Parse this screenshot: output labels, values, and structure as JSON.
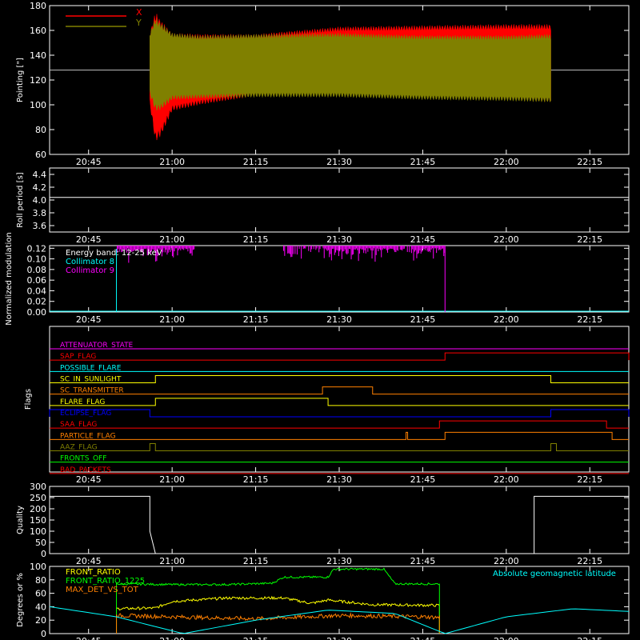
{
  "time_ticks": [
    "20:45",
    "21:00",
    "21:15",
    "21:30",
    "21:45",
    "22:00",
    "22:15"
  ],
  "colors": {
    "background": "#000000",
    "axis": "#ffffff",
    "x_pointing": "#ff0000",
    "y_pointing": "#808000",
    "collimator8": "#00ffff",
    "collimator9": "#ff00ff",
    "front_ratio": "#ffff00",
    "front_ratio_1225": "#00ff00",
    "max_det_vs_tot": "#ff8000",
    "geomag": "#00ffff"
  },
  "chart_data": [
    {
      "id": "pointing",
      "type": "line",
      "title": "",
      "ylabel": "Pointing [\"]",
      "xlim": [
        "20:38",
        "22:22"
      ],
      "ylim": [
        60,
        180
      ],
      "yticks": [
        "60",
        "80",
        "100",
        "120",
        "140",
        "160",
        "180"
      ],
      "reference_line": 128,
      "legend": {
        "placement": "top-left",
        "entries": [
          "X",
          "Y"
        ]
      },
      "series": [
        {
          "name": "X",
          "x": [
            "20:56",
            "20:57",
            "20:58",
            "21:00",
            "21:05",
            "21:15",
            "21:30",
            "21:45",
            "22:00",
            "22:08"
          ],
          "upper": [
            158,
            175,
            168,
            158,
            157,
            157,
            163,
            164,
            165,
            165
          ],
          "lower": [
            100,
            70,
            75,
            95,
            100,
            107,
            108,
            107,
            104,
            102
          ]
        },
        {
          "name": "Y",
          "x": [
            "20:56",
            "20:57",
            "20:58",
            "21:00",
            "21:05",
            "21:15",
            "21:30",
            "21:45",
            "22:00",
            "22:08"
          ],
          "upper": [
            158,
            170,
            166,
            158,
            156,
            157,
            158,
            156,
            156,
            157
          ],
          "lower": [
            108,
            95,
            96,
            104,
            105,
            106,
            106,
            104,
            103,
            102
          ]
        }
      ]
    },
    {
      "id": "roll",
      "type": "line",
      "ylabel": "Roll period [s]",
      "ylim": [
        3.5,
        4.5
      ],
      "yticks": [
        "3.6",
        "3.8",
        "4.0",
        "4.2",
        "4.4"
      ],
      "series": [
        {
          "x": [
            "20:38",
            "22:22"
          ],
          "y": [
            4.04,
            4.04
          ]
        }
      ]
    },
    {
      "id": "modulation",
      "type": "bar",
      "ylabel": "Normalized modulation",
      "ylim": [
        0,
        0.125
      ],
      "yticks": [
        "0.00",
        "0.02",
        "0.04",
        "0.06",
        "0.08",
        "0.10",
        "0.12"
      ],
      "legend": {
        "placement": "top-left",
        "entries": [
          "Energy band: 12-25 keV",
          "Collimator 8",
          "Collimator 9"
        ]
      },
      "span": [
        "20:50",
        "21:49"
      ],
      "dense_level": 0.12,
      "gaps": [
        {
          "from": "21:04",
          "to": "21:19"
        },
        {
          "from": "21:19",
          "to": "21:27",
          "sparse": true
        },
        {
          "from": "21:40",
          "to": "21:43",
          "sparse": true
        }
      ]
    },
    {
      "id": "flags",
      "type": "line",
      "ylabel": "Flags",
      "rows": [
        {
          "name": "ATTENUATOR_STATE",
          "color": "#ff00ff",
          "high": []
        },
        {
          "name": "SAP_FLAG",
          "color": "#ff0000",
          "high": [
            [
              "21:49",
              "22:22"
            ]
          ]
        },
        {
          "name": "POSSIBLE_FLARE",
          "color": "#00ffff",
          "high": []
        },
        {
          "name": "SC_IN_SUNLIGHT",
          "color": "#ffff00",
          "high": [
            [
              "20:57",
              "22:08"
            ]
          ]
        },
        {
          "name": "SC_TRANSMITTER",
          "color": "#ff8000",
          "high": [
            [
              "21:27",
              "21:36"
            ]
          ]
        },
        {
          "name": "FLARE_FLAG",
          "color": "#ffff00",
          "high": [
            [
              "20:57",
              "21:28"
            ]
          ]
        },
        {
          "name": "ECLIPSE_FLAG",
          "color": "#0000ff",
          "high": [
            [
              "20:38",
              "20:56"
            ],
            [
              "22:08",
              "22:22"
            ]
          ]
        },
        {
          "name": "SAA_FLAG",
          "color": "#ff0000",
          "high": [
            [
              "21:48",
              "22:18"
            ]
          ]
        },
        {
          "name": "PARTICLE_FLAG",
          "color": "#ff8000",
          "high": [
            [
              "21:42",
              "21:42"
            ],
            [
              "21:49",
              "22:19"
            ]
          ]
        },
        {
          "name": "AAZ_FLAG",
          "color": "#808000",
          "high": [
            [
              "20:56",
              "20:57"
            ],
            [
              "22:08",
              "22:09"
            ]
          ]
        },
        {
          "name": "FRONTS_OFF",
          "color": "#00ff00",
          "high": []
        },
        {
          "name": "BAD_PACKETS",
          "color": "#ff0000",
          "high": []
        }
      ]
    },
    {
      "id": "quality",
      "type": "line",
      "ylabel": "Quality",
      "ylim": [
        0,
        300
      ],
      "yticks": [
        "0",
        "50",
        "100",
        "150",
        "200",
        "250",
        "300"
      ],
      "series": [
        {
          "x": [
            "20:38",
            "20:56",
            "20:56",
            "20:57",
            "22:05",
            "22:05",
            "22:22"
          ],
          "y": [
            256,
            256,
            100,
            0,
            0,
            256,
            256
          ]
        }
      ]
    },
    {
      "id": "ratios",
      "type": "line",
      "ylabel": "Degrees or %",
      "ylim": [
        0,
        100
      ],
      "yticks": [
        "0",
        "20",
        "40",
        "60",
        "80",
        "100"
      ],
      "legend": {
        "placement": "top",
        "entries": [
          "FRONT_RATIO",
          "FRONT_RATIO_1225",
          "MAX_DET_VS_TOT",
          "Absolute geomagnetic latitude"
        ]
      },
      "series": [
        {
          "name": "FRONT_RATIO",
          "x": [
            "20:50",
            "20:57",
            "21:00",
            "21:10",
            "21:20",
            "21:25",
            "21:28",
            "21:36",
            "21:48"
          ],
          "y": [
            37,
            38,
            48,
            53,
            53,
            45,
            50,
            43,
            42
          ]
        },
        {
          "name": "FRONT_RATIO_1225",
          "x": [
            "20:50",
            "21:00",
            "21:10",
            "21:18",
            "21:20",
            "21:28",
            "21:29",
            "21:38",
            "21:40",
            "21:48"
          ],
          "y": [
            74,
            73,
            73,
            75,
            84,
            84,
            96,
            96,
            74,
            74
          ]
        },
        {
          "name": "MAX_DET_VS_TOT",
          "x": [
            "20:50",
            "21:00",
            "21:15",
            "21:30",
            "21:45",
            "21:48"
          ],
          "y": [
            27,
            25,
            22,
            27,
            25,
            24
          ]
        },
        {
          "name": "Absolute geomagnetic latitude",
          "x": [
            "20:38",
            "20:50",
            "21:02",
            "21:15",
            "21:28",
            "21:40",
            "21:49",
            "22:00",
            "22:12",
            "22:22"
          ],
          "y": [
            40,
            25,
            0,
            20,
            35,
            30,
            0,
            25,
            37,
            33
          ]
        }
      ]
    }
  ]
}
